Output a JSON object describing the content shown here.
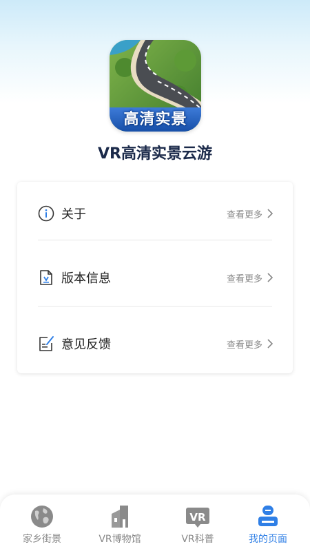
{
  "app": {
    "icon_caption": "高清实景",
    "title": "VR高清实景云游"
  },
  "menu": {
    "items": [
      {
        "label": "关于",
        "more": "查看更多",
        "icon": "info-circle-icon"
      },
      {
        "label": "版本信息",
        "more": "查看更多",
        "icon": "document-version-icon"
      },
      {
        "label": "意见反馈",
        "more": "查看更多",
        "icon": "feedback-edit-icon"
      }
    ]
  },
  "tabbar": {
    "active_color": "#2f7fe6",
    "inactive_color": "#888888",
    "tabs": [
      {
        "label": "家乡街景",
        "icon": "globe-icon",
        "active": false
      },
      {
        "label": "VR博物馆",
        "icon": "building-icon",
        "active": false
      },
      {
        "label": "VR科普",
        "icon": "vr-badge-icon",
        "active": false
      },
      {
        "label": "我的页面",
        "icon": "user-profile-icon",
        "active": true
      }
    ]
  }
}
